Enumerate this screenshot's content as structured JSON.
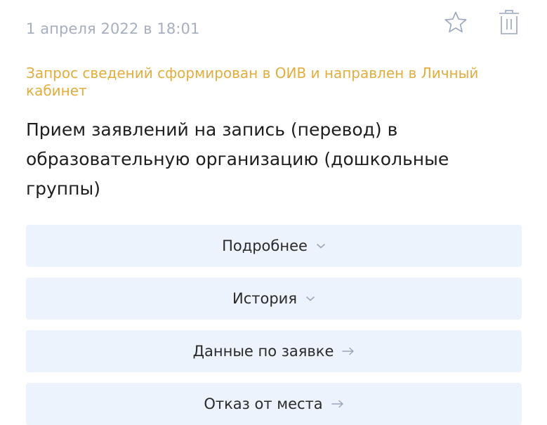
{
  "card": {
    "date": "1 апреля 2022 в 18:01",
    "status": "Запрос сведений сформирован в ОИВ и направлен в Личный кабинет",
    "title": "Прием заявлений на запись (перевод) в образовательную организацию (дошкольные группы)",
    "icons": {
      "favorite": "star-icon",
      "delete": "trash-icon"
    }
  },
  "actions": [
    {
      "label": "Подробнее",
      "icon": "chevron-down-icon"
    },
    {
      "label": "История",
      "icon": "chevron-down-icon"
    },
    {
      "label": "Данные по заявке",
      "icon": "arrow-right-icon"
    },
    {
      "label": "Отказ от места",
      "icon": "arrow-right-icon"
    }
  ],
  "colors": {
    "status": "#e3ad3e",
    "date": "#a7aebf",
    "button_bg": "#edf3fc",
    "icon": "#9aa6bb"
  }
}
